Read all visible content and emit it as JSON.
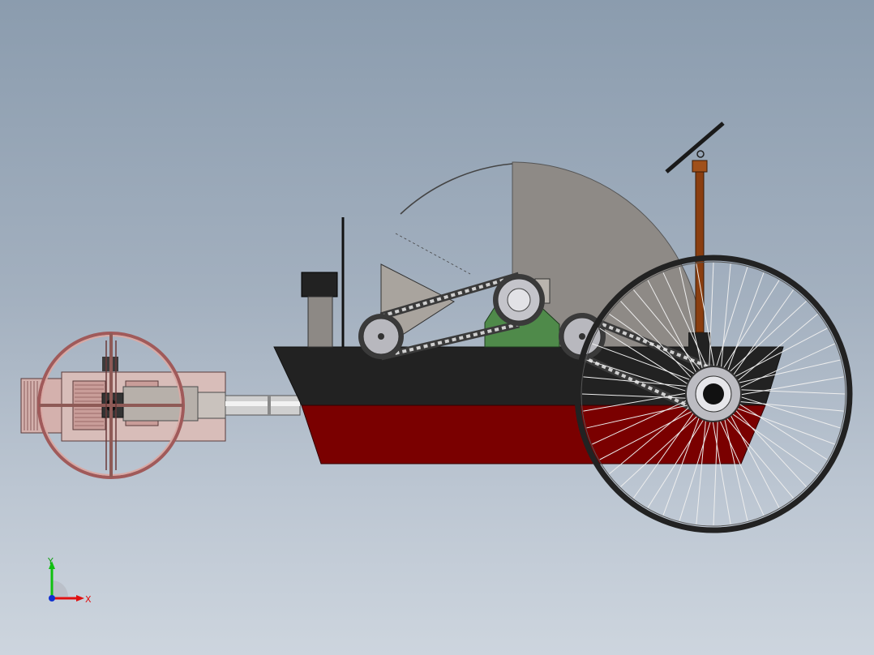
{
  "viewport": {
    "background_top": "#8b9cae",
    "background_bottom": "#cdd5de"
  },
  "model": {
    "hull_upper_color": "#222222",
    "hull_lower_color": "#7a0000",
    "fan_sector_color": "#8e8a86",
    "tiller_color": "#8a3e10",
    "rear_frame_color": "#c9a3a0"
  },
  "triad": {
    "x_label": "X",
    "y_label": "Y",
    "x_color": "#e01010",
    "y_color": "#10c010",
    "z_color": "#1030d0"
  }
}
